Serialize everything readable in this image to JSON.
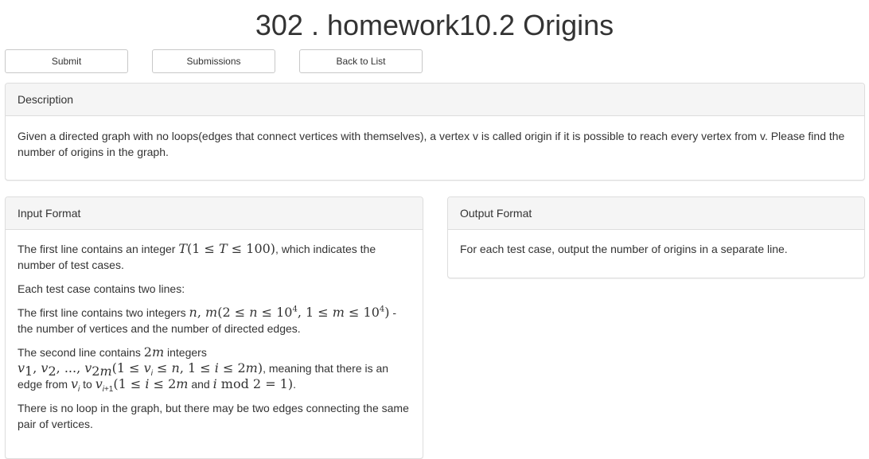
{
  "page": {
    "title": "302 . homework10.2 Origins"
  },
  "toolbar": {
    "submit_label": "Submit",
    "submissions_label": "Submissions",
    "back_label": "Back to List"
  },
  "description": {
    "heading": "Description",
    "text": "Given a directed graph with no loops(edges that connect vertices with themselves), a vertex v is called origin if it is possible to reach every vertex from v. Please find the number of origins in the graph."
  },
  "input_format": {
    "heading": "Input Format",
    "p1_pre": "The first line contains an integer ",
    "p1_post": ", which indicates the number of test cases.",
    "p2": "Each test case contains two lines:",
    "p3_pre": "The first line contains two integers ",
    "p3_post": " - the number of vertices and the number of directed edges.",
    "p4_pre": "The second line contains ",
    "p4_mid": " integers",
    "p4_mid2": ", meaning that there is an edge from ",
    "p4_to": " to ",
    "p4_and": " and ",
    "p4_end": ".",
    "p5": "There is no loop in the graph, but there may be two edges connecting the same pair of vertices."
  },
  "output_format": {
    "heading": "Output Format",
    "text": "For each test case, output the number of origins in a separate line."
  }
}
